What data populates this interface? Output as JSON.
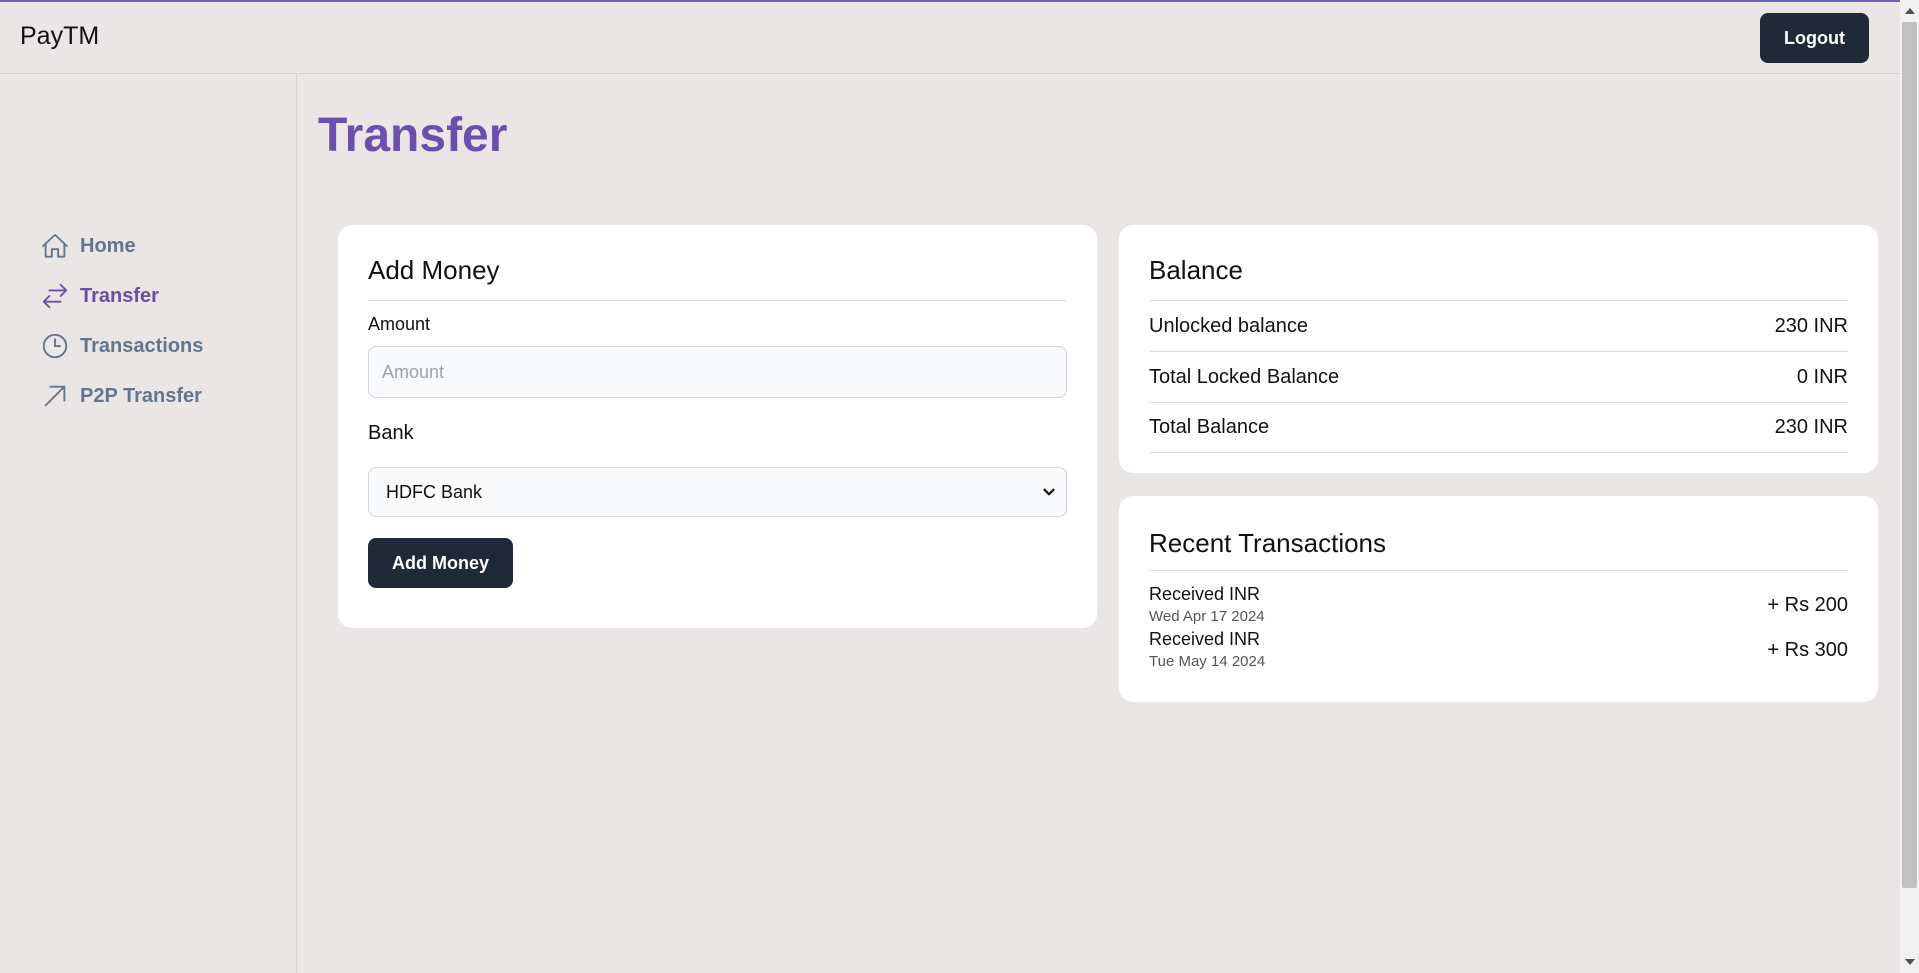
{
  "app": {
    "brand": "PayTM",
    "logout_label": "Logout"
  },
  "sidebar": {
    "items": [
      {
        "label": "Home",
        "icon": "home-icon"
      },
      {
        "label": "Transfer",
        "icon": "arrows-right-left-icon",
        "active": true
      },
      {
        "label": "Transactions",
        "icon": "clock-icon"
      },
      {
        "label": "P2P Transfer",
        "icon": "arrow-up-right-icon"
      }
    ]
  },
  "page": {
    "title": "Transfer"
  },
  "add_money": {
    "title": "Add Money",
    "amount_label": "Amount",
    "amount_placeholder": "Amount",
    "amount_value": "",
    "bank_label": "Bank",
    "bank_selected": "HDFC Bank",
    "button_label": "Add Money"
  },
  "balance": {
    "title": "Balance",
    "rows": [
      {
        "label": "Unlocked balance",
        "value": "230 INR"
      },
      {
        "label": "Total Locked Balance",
        "value": "0 INR"
      },
      {
        "label": "Total Balance",
        "value": "230 INR"
      }
    ]
  },
  "recent_transactions": {
    "title": "Recent Transactions",
    "items": [
      {
        "title": "Received INR",
        "date": "Wed Apr 17 2024",
        "amount": "+ Rs 200"
      },
      {
        "title": "Received INR",
        "date": "Tue May 14 2024",
        "amount": "+ Rs 300"
      }
    ]
  },
  "colors": {
    "accent": "#6a4fae",
    "nav_inactive": "#64748b",
    "button_dark": "#1f2937",
    "background": "#ebe6e6"
  }
}
